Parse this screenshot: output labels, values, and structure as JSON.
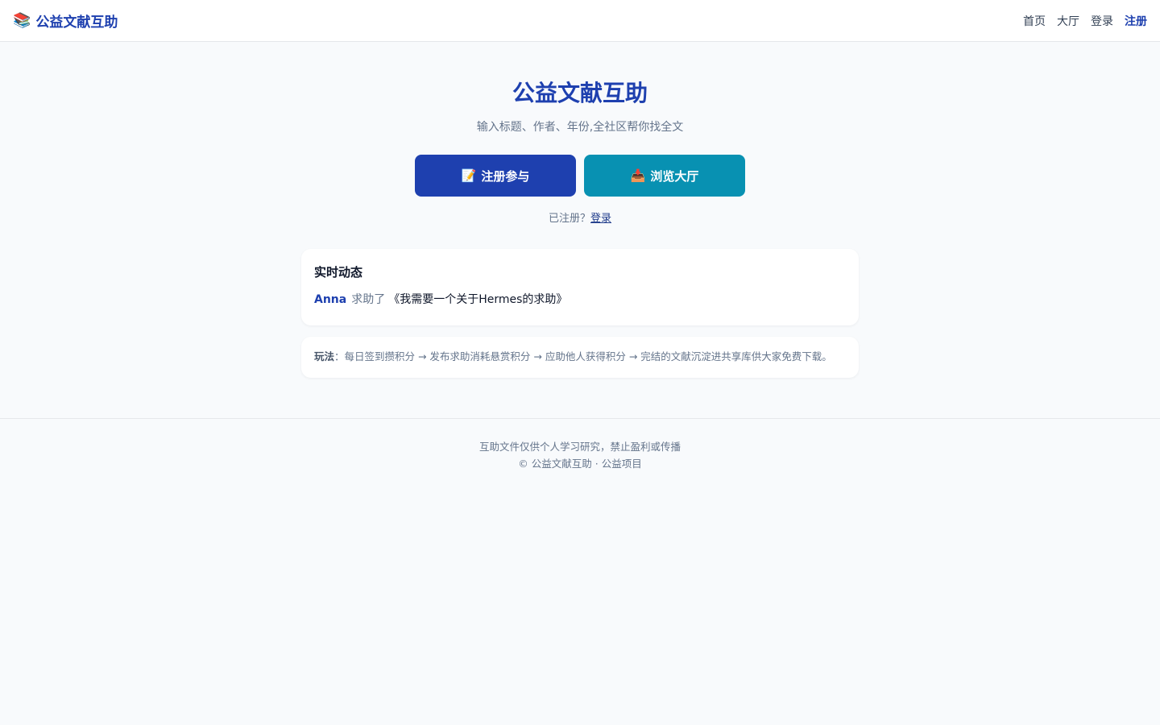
{
  "header": {
    "brand_icon": "📚",
    "brand_name": "公益文献互助",
    "nav": [
      {
        "label": "首页"
      },
      {
        "label": "大厅"
      },
      {
        "label": "登录"
      },
      {
        "label": "注册",
        "active": true
      }
    ]
  },
  "hero": {
    "title": "公益文献互助",
    "subtitle": "输入标题、作者、年份,全社区帮你找全文",
    "primary_button": {
      "icon": "📝",
      "label": "注册参与"
    },
    "secondary_button": {
      "icon": "📥",
      "label": "浏览大厅"
    },
    "login_prompt": "已注册？",
    "login_link": "登录"
  },
  "activity": {
    "title": "实时动态",
    "items": [
      {
        "user": "Anna",
        "action": "求助了",
        "title": "《我需要一个关于Hermes的求助》"
      }
    ]
  },
  "rules": {
    "label": "玩法",
    "text": "：每日签到攒积分 → 发布求助消耗悬赏积分 → 应助他人获得积分 → 完结的文献沉淀进共享库供大家免费下载。"
  },
  "footer": {
    "line1": "互助文件仅供个人学习研究，禁止盈利或传播",
    "line2": "© 公益文献互助 · 公益项目"
  },
  "colors": {
    "brand": "#1e40af",
    "secondary": "#0891b2",
    "background": "#f8fafc"
  }
}
